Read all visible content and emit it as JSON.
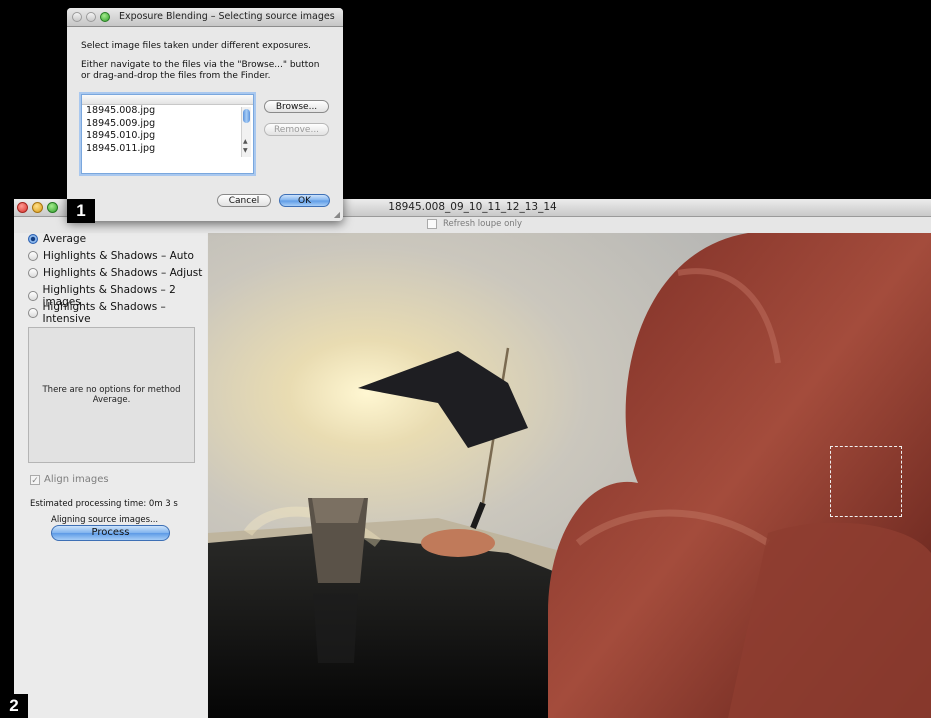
{
  "main_window": {
    "title": "18945.008_09_10_11_12_13_14",
    "refresh_label": "Refresh loupe only",
    "methods": [
      {
        "label": "Average",
        "selected": true
      },
      {
        "label": "Highlights & Shadows – Auto",
        "selected": false
      },
      {
        "label": "Highlights & Shadows – Adjust",
        "selected": false
      },
      {
        "label": "Highlights & Shadows – 2 images",
        "selected": false
      },
      {
        "label": "Highlights & Shadows – Intensive",
        "selected": false
      }
    ],
    "options_text": "There are no options for method Average.",
    "align_label": "Align images",
    "estimated_time": "Estimated processing time:  0m  3 s",
    "status_text": "Aligning source images...",
    "process_label": "Process"
  },
  "dialog": {
    "title": "Exposure Blending – Selecting source images",
    "instruction1": "Select image files taken under different exposures.",
    "instruction2_line1": "Either navigate to the files via the \"Browse...\" button",
    "instruction2_line2": "or drag-and-drop the files from the Finder.",
    "files": [
      "18945.008.jpg",
      "18945.009.jpg",
      "18945.010.jpg",
      "18945.011.jpg"
    ],
    "browse_label": "Browse...",
    "remove_label": "Remove...",
    "cancel_label": "Cancel",
    "ok_label": "OK"
  },
  "badges": {
    "one": "1",
    "two": "2"
  },
  "colors": {
    "accent_blue": "#5c9ae6",
    "close_red": "#e0443e",
    "minimize_yellow": "#e8b22a",
    "zoom_green": "#3fb33a"
  }
}
